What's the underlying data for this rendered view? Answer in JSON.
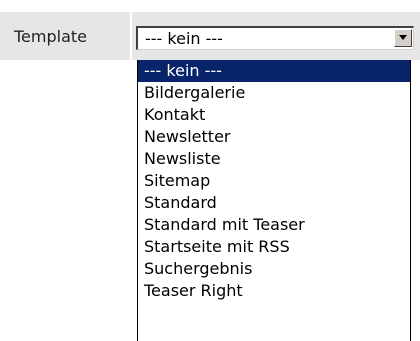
{
  "form": {
    "label": "Template",
    "select": {
      "value": "--- kein ---",
      "dropdown_arrow_icon": "triangle-down-icon"
    }
  },
  "dropdown": {
    "options": [
      "--- kein ---",
      "Bildergalerie",
      "Kontakt",
      "Newsletter",
      "Newsliste",
      "Sitemap",
      "Standard",
      "Standard mit Teaser",
      "Startseite mit RSS",
      "Suchergebnis",
      "Teaser Right"
    ],
    "highlighted_option": "--- kein ---"
  },
  "colors": {
    "row_background": "#e6e6e6",
    "highlight": "#0a246a",
    "button_face": "#d4d0c8"
  }
}
